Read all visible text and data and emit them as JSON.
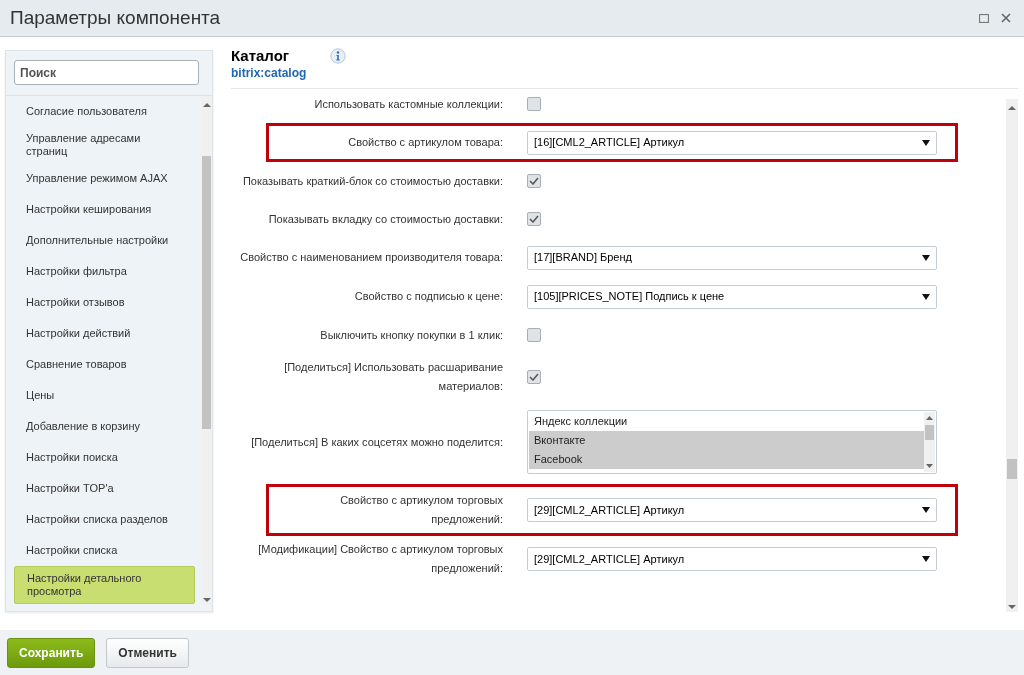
{
  "window": {
    "title": "Параметры компонента"
  },
  "sidebar": {
    "search": {
      "placeholder": "Поиск"
    },
    "items": [
      {
        "label": "Согласие пользователя",
        "selected": false
      },
      {
        "label": "Управление адресами страниц",
        "selected": false
      },
      {
        "label": "Управление режимом AJAX",
        "selected": false
      },
      {
        "label": "Настройки кеширования",
        "selected": false
      },
      {
        "label": "Дополнительные настройки",
        "selected": false
      },
      {
        "label": "Настройки фильтра",
        "selected": false
      },
      {
        "label": "Настройки отзывов",
        "selected": false
      },
      {
        "label": "Настройки действий",
        "selected": false
      },
      {
        "label": "Сравнение товаров",
        "selected": false
      },
      {
        "label": "Цены",
        "selected": false
      },
      {
        "label": "Добавление в корзину",
        "selected": false
      },
      {
        "label": "Настройки поиска",
        "selected": false
      },
      {
        "label": "Настройки TOP'а",
        "selected": false
      },
      {
        "label": "Настройки списка разделов",
        "selected": false
      },
      {
        "label": "Настройки списка",
        "selected": false
      },
      {
        "label": "Настройки детального просмотра",
        "selected": true
      }
    ]
  },
  "component": {
    "title": "Каталог",
    "code": "bitrix:catalog"
  },
  "params": [
    {
      "kind": "checkbox",
      "label": "Использовать кастомные коллекции:",
      "checked": false,
      "highlighted": false
    },
    {
      "kind": "select",
      "label": "Свойство с артикулом товара:",
      "value": "[16][CML2_ARTICLE] Артикул",
      "highlighted": true
    },
    {
      "kind": "checkbox",
      "label": "Показывать краткий-блок со стоимостью доставки:",
      "checked": true,
      "highlighted": false
    },
    {
      "kind": "checkbox",
      "label": "Показывать вкладку со стоимостью доставки:",
      "checked": true,
      "highlighted": false
    },
    {
      "kind": "select",
      "label": "Свойство с наименованием производителя товара:",
      "value": "[17][BRAND] Бренд",
      "highlighted": false
    },
    {
      "kind": "select",
      "label": "Свойство с подписью к цене:",
      "value": "[105][PRICES_NOTE] Подпись к цене",
      "highlighted": false
    },
    {
      "kind": "checkbox",
      "label": "Выключить кнопку покупки в 1 клик:",
      "checked": false,
      "highlighted": false
    },
    {
      "kind": "checkbox",
      "label": "[Поделиться] Использовать расшаривание материалов:",
      "checked": true,
      "highlighted": false
    },
    {
      "kind": "multiselect",
      "label": "[Поделиться] В каких соцсетях можно поделится:",
      "highlighted": false,
      "options": [
        {
          "label": "Яндекс коллекции",
          "selected": false
        },
        {
          "label": "Вконтакте",
          "selected": true
        },
        {
          "label": "Facebook",
          "selected": true
        }
      ]
    },
    {
      "kind": "select",
      "label": "Свойство с артикулом торговых предложений:",
      "value": "[29][CML2_ARTICLE] Артикул",
      "highlighted": true
    },
    {
      "kind": "select",
      "label": "[Модификации] Свойство с артикулом торговых предложений:",
      "value": "[29][CML2_ARTICLE] Артикул",
      "highlighted": false
    }
  ],
  "buttons": [
    {
      "label": "Сохранить",
      "kind": "primary"
    },
    {
      "label": "Отменить",
      "kind": "secondary"
    }
  ]
}
